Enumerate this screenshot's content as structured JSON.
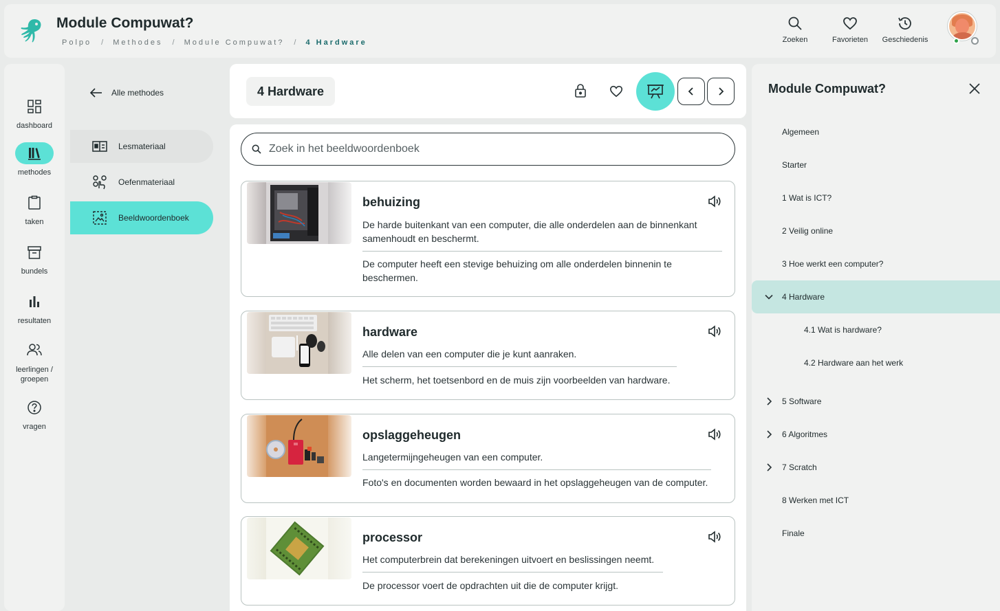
{
  "header": {
    "title": "Module Compuwat?",
    "breadcrumb": [
      "Polpo",
      "Methodes",
      "Module Compuwat?",
      "4 Hardware"
    ],
    "breadcrumb_sep": "/",
    "actions": {
      "search": "Zoeken",
      "favorites": "Favorieten",
      "history": "Geschiedenis"
    },
    "accent": "#5ce1d6",
    "logo_color": "#2fb9a9"
  },
  "leftnav": {
    "items": [
      {
        "label": "dashboard",
        "icon": "dashboard-icon"
      },
      {
        "label": "methodes",
        "icon": "books-icon",
        "active": true
      },
      {
        "label": "taken",
        "icon": "clipboard-icon"
      },
      {
        "label": "bundels",
        "icon": "archive-icon"
      },
      {
        "label": "resultaten",
        "icon": "bar-chart-icon"
      },
      {
        "label": "leerlingen / groepen",
        "icon": "people-icon"
      },
      {
        "label": "vragen",
        "icon": "question-icon"
      }
    ]
  },
  "submenu": {
    "back_label": "Alle methodes",
    "items": [
      {
        "label": "Lesmateriaal",
        "icon": "lesson-material-icon"
      },
      {
        "label": "Oefenmateriaal",
        "icon": "practice-material-icon"
      },
      {
        "label": "Beeldwoordenboek",
        "icon": "picture-dictionary-icon",
        "active": true
      }
    ]
  },
  "main": {
    "chapter_title": "4 Hardware",
    "search_placeholder": "Zoek in het beeldwoordenboek",
    "entries": [
      {
        "word": "behuizing",
        "definition": "De harde buitenkant van een computer, die alle onderdelen aan de binnenkant samenhoudt en beschermt.",
        "example": "De computer heeft een stevige behuizing om alle onderdelen binnenin te beschermen."
      },
      {
        "word": "hardware",
        "definition": "Alle delen van een computer die je kunt aanraken.",
        "example": "Het scherm, het toetsenbord en de muis zijn voorbeelden van hardware."
      },
      {
        "word": "opslaggeheugen",
        "definition": "Langetermijngeheugen van een computer.",
        "example": "Foto's en documenten worden bewaard in het opslaggeheugen van de computer."
      },
      {
        "word": "processor",
        "definition": "Het computerbrein dat berekeningen uitvoert en beslissingen neemt.",
        "example": "De processor voert de opdrachten uit die de computer krijgt."
      }
    ]
  },
  "rightpanel": {
    "title": "Module Compuwat?",
    "toc": [
      {
        "label": "Algemeen"
      },
      {
        "label": "Starter"
      },
      {
        "label": "1 Wat is ICT?"
      },
      {
        "label": "2 Veilig online"
      },
      {
        "label": "3 Hoe werkt een computer?"
      },
      {
        "label": "4 Hardware",
        "expanded": true,
        "active": true
      },
      {
        "label": "4.1 Wat is hardware?",
        "sub": true
      },
      {
        "label": "4.2 Hardware aan het werk",
        "sub": true
      },
      {
        "label": "5 Software",
        "collapsed": true
      },
      {
        "label": "6 Algoritmes",
        "collapsed": true
      },
      {
        "label": "7 Scratch",
        "collapsed": true
      },
      {
        "label": "8 Werken met ICT"
      },
      {
        "label": "Finale"
      }
    ]
  }
}
